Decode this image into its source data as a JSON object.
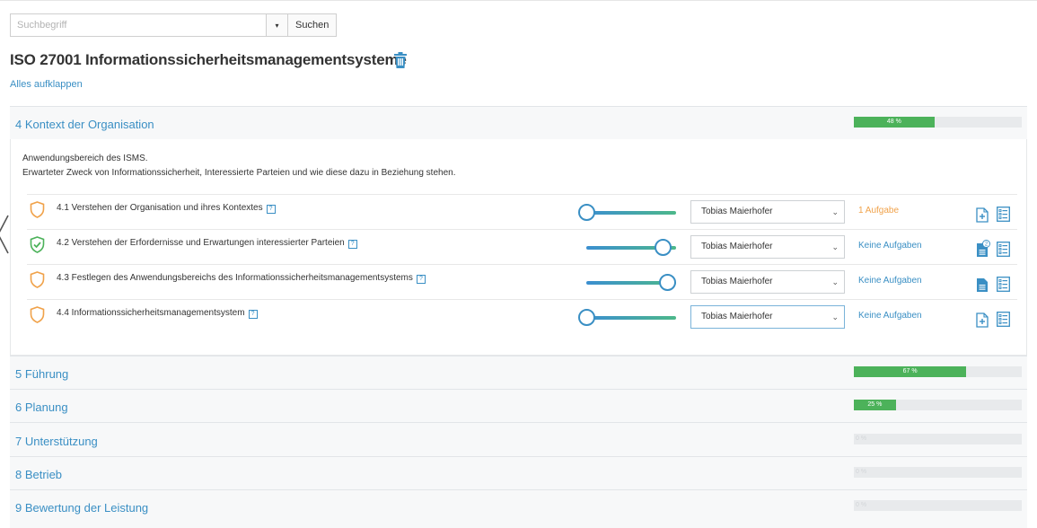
{
  "search": {
    "placeholder": "Suchbegriff",
    "button_label": "Suchen",
    "dropdown_caret": "▾"
  },
  "page": {
    "title": "ISO 27001 Informationssicherheitsmanagementsysteme",
    "expand_all": "Alles aufklappen"
  },
  "colors": {
    "accent": "#3a8fc4",
    "progress": "#4cb25a",
    "warning": "#f0a24a"
  },
  "sections": [
    {
      "title": "4 Kontext der Organisation",
      "progress_percent": 48,
      "progress_label": "48 %",
      "expanded": true
    },
    {
      "title": "5 Führung",
      "progress_percent": 67,
      "progress_label": "67 %",
      "expanded": false
    },
    {
      "title": "6 Planung",
      "progress_percent": 25,
      "progress_label": "25 %",
      "expanded": false
    },
    {
      "title": "7 Unterstützung",
      "progress_percent": 0,
      "progress_label": "0 %",
      "expanded": false
    },
    {
      "title": "8 Betrieb",
      "progress_percent": 0,
      "progress_label": "0 %",
      "expanded": false
    },
    {
      "title": "9 Bewertung der Leistung",
      "progress_percent": 0,
      "progress_label": "0 %",
      "expanded": false
    }
  ],
  "expanded_section": {
    "description_line1": "Anwendungsbereich des ISMS.",
    "description_line2": "Erwarteter Zweck von Informationssicherheit, Interessierte Parteien und wie diese dazu in Beziehung stehen.",
    "help_symbol": "?",
    "select_chevron": "⌄",
    "rows": [
      {
        "label": "4.1 Verstehen der Organisation und ihres Kontextes",
        "status_icon": "shield-orange-icon",
        "slider_fraction": 0.0,
        "assignee": "Tobias Maierhofer",
        "tasks": "1 Aufgabe",
        "tasks_color": "orange",
        "doc_icon": "document-add-icon",
        "doc_badge": ""
      },
      {
        "label": "4.2 Verstehen der Erfordernisse und Erwartungen interessierter Parteien",
        "status_icon": "shield-check-green-icon",
        "slider_fraction": 0.85,
        "assignee": "Tobias Maierhofer",
        "tasks": "Keine Aufgaben",
        "tasks_color": "blue",
        "doc_icon": "document-filled-icon",
        "doc_badge": "2"
      },
      {
        "label": "4.3 Festlegen des Anwendungsbereichs des Informationssicherheitsmanagementsystems",
        "status_icon": "shield-orange-icon",
        "slider_fraction": 0.9,
        "assignee": "Tobias Maierhofer",
        "tasks": "Keine Aufgaben",
        "tasks_color": "blue",
        "doc_icon": "document-filled-icon",
        "doc_badge": ""
      },
      {
        "label": "4.4 Informationssicherheitsmanagementsystem",
        "status_icon": "shield-orange-icon",
        "slider_fraction": 0.0,
        "assignee": "Tobias Maierhofer",
        "tasks": "Keine Aufgaben",
        "tasks_color": "blue",
        "doc_icon": "document-add-icon",
        "doc_badge": ""
      }
    ]
  }
}
